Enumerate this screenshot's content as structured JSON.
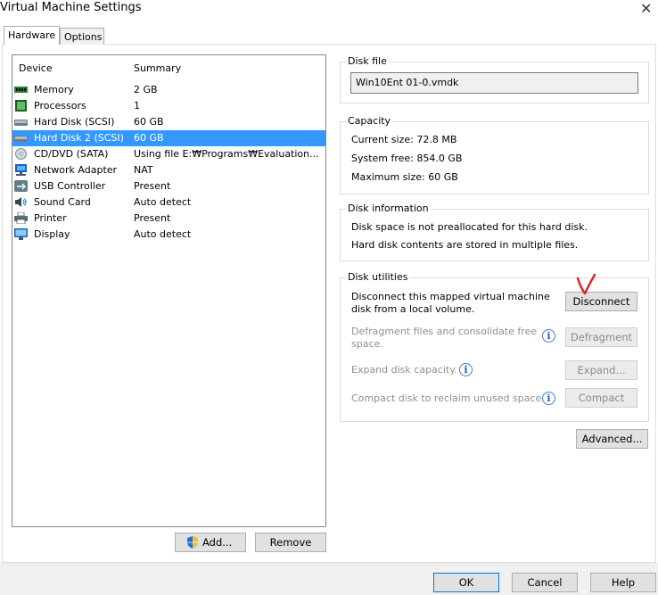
{
  "window": {
    "title": "Virtual Machine Settings",
    "close_glyph": "✕"
  },
  "tabs": [
    {
      "label": "Hardware",
      "active": true
    },
    {
      "label": "Options",
      "active": false
    }
  ],
  "device_list": {
    "columns": {
      "device": "Device",
      "summary": "Summary"
    },
    "rows": [
      {
        "name": "Memory",
        "summary": "2 GB",
        "icon": "memory-icon"
      },
      {
        "name": "Processors",
        "summary": "1",
        "icon": "processor-icon"
      },
      {
        "name": "Hard Disk (SCSI)",
        "summary": "60 GB",
        "icon": "hard-disk-icon"
      },
      {
        "name": "Hard Disk 2 (SCSI)",
        "summary": "60 GB",
        "icon": "hard-disk-icon",
        "selected": true
      },
      {
        "name": "CD/DVD (SATA)",
        "summary": "Using file E:₩Programs₩Evaluation...",
        "icon": "cd-dvd-icon"
      },
      {
        "name": "Network Adapter",
        "summary": "NAT",
        "icon": "network-adapter-icon"
      },
      {
        "name": "USB Controller",
        "summary": "Present",
        "icon": "usb-icon"
      },
      {
        "name": "Sound Card",
        "summary": "Auto detect",
        "icon": "speaker-icon"
      },
      {
        "name": "Printer",
        "summary": "Present",
        "icon": "printer-icon"
      },
      {
        "name": "Display",
        "summary": "Auto detect",
        "icon": "display-icon"
      }
    ]
  },
  "list_buttons": {
    "add": "Add...",
    "remove": "Remove"
  },
  "disk_file": {
    "label": "Disk file",
    "value": "Win10Ent 01-0.vmdk"
  },
  "capacity": {
    "label": "Capacity",
    "current": "Current size: 72.8 MB",
    "free": "System free: 854.0 GB",
    "max": "Maximum size: 60 GB"
  },
  "disk_info": {
    "label": "Disk information",
    "line1": "Disk space is not preallocated for this hard disk.",
    "line2": "Hard disk contents are stored in multiple files."
  },
  "disk_utilities": {
    "label": "Disk utilities",
    "disconnect_line1": "Disconnect this mapped virtual machine",
    "disconnect_line2": "disk from a local volume.",
    "disconnect_button": "Disconnect",
    "defrag_line1": "Defragment files and consolidate free",
    "defrag_line2": "space.",
    "defrag_button": "Defragment",
    "expand_text": "Expand disk capacity.",
    "expand_button": "Expand...",
    "compact_text": "Compact disk to reclaim unused space.",
    "compact_button": "Compact"
  },
  "advanced_button": "Advanced...",
  "footer": {
    "ok": "OK",
    "cancel": "Cancel",
    "help": "Help"
  },
  "colors": {
    "selection": "#3399ff",
    "annotation": "#e02020",
    "accent_border": "#0078d7"
  }
}
